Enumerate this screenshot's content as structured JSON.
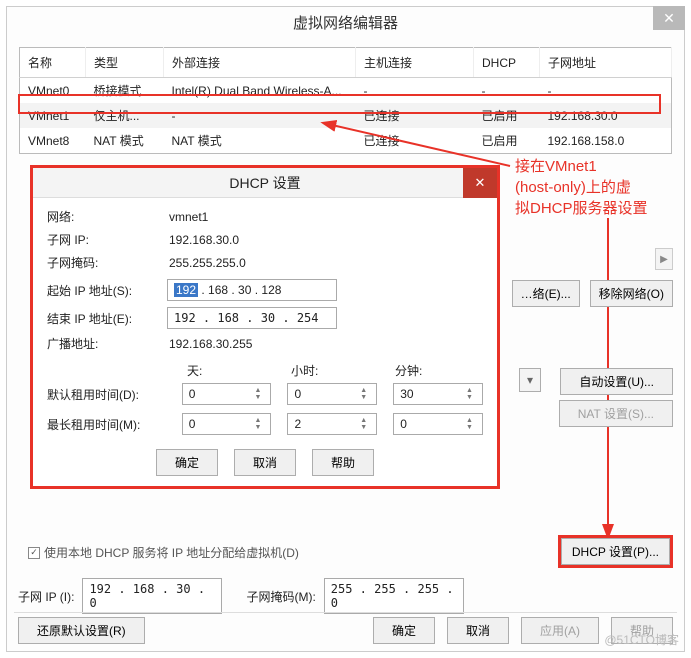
{
  "window_title": "虚拟网络编辑器",
  "close_x": "✕",
  "columns": {
    "name": "名称",
    "type": "类型",
    "external": "外部连接",
    "host": "主机连接",
    "dhcp": "DHCP",
    "subnet": "子网地址"
  },
  "rows": [
    {
      "name": "VMnet0",
      "type": "桥接模式",
      "external": "Intel(R) Dual Band Wireless-A...",
      "host": "-",
      "dhcp": "-",
      "subnet": "-"
    },
    {
      "name": "VMnet1",
      "type": "仅主机...",
      "external": "-",
      "host": "已连接",
      "dhcp": "已启用",
      "subnet": "192.168.30.0"
    },
    {
      "name": "VMnet8",
      "type": "NAT 模式",
      "external": "NAT 模式",
      "host": "已连接",
      "dhcp": "已启用",
      "subnet": "192.168.158.0"
    }
  ],
  "annotation": "接在VMnet1\n(host-only)上的虚\n拟DHCP服务器设置",
  "annotation_lines": {
    "l1": "接在VMnet1",
    "l2": "(host-only)上的虚",
    "l3": "拟DHCP服务器设置"
  },
  "dialog": {
    "title": "DHCP 设置",
    "close": "✕",
    "network_label": "网络:",
    "network_val": "vmnet1",
    "subip_label": "子网 IP:",
    "subip_val": "192.168.30.0",
    "mask_label": "子网掩码:",
    "mask_val": "255.255.255.0",
    "start_label": "起始 IP 地址(S):",
    "start_sel": "192",
    "start_rest": " . 168 . 30 . 128",
    "end_label": "结束 IP 地址(E):",
    "end_val": "192 . 168 . 30 . 254",
    "broadcast_label": "广播地址:",
    "broadcast_val": "192.168.30.255",
    "day": "天:",
    "hour": "小时:",
    "minute": "分钟:",
    "default_lease_label": "默认租用时间(D):",
    "default_lease": {
      "d": "0",
      "h": "0",
      "m": "30"
    },
    "max_lease_label": "最长租用时间(M):",
    "max_lease": {
      "d": "0",
      "h": "2",
      "m": "0"
    },
    "ok": "确定",
    "cancel": "取消",
    "help": "帮助"
  },
  "side": {
    "add_net": "…络(E)...",
    "remove_net": "移除网络(O)",
    "auto": "自动设置(U)...",
    "nat": "NAT 设置(S)...",
    "scroll_arrow": "▶"
  },
  "dhcp_btn": "DHCP 设置(P)...",
  "checkbox_text": "使用本地 DHCP 服务将 IP 地址分配给虚拟机(D)",
  "check_mark": "✓",
  "subnet": {
    "ip_label": "子网 IP (I):",
    "ip_val": "192 . 168 . 30 . 0",
    "mask_label": "子网掩码(M):",
    "mask_val": "255 . 255 . 255 . 0"
  },
  "bottom": {
    "restore": "还原默认设置(R)",
    "ok": "确定",
    "cancel": "取消",
    "apply": "应用(A)",
    "help": "帮助"
  },
  "watermark": "@51CTO博客",
  "spin_up": "▲",
  "spin_dn": "▼",
  "chevron_down": "▾"
}
